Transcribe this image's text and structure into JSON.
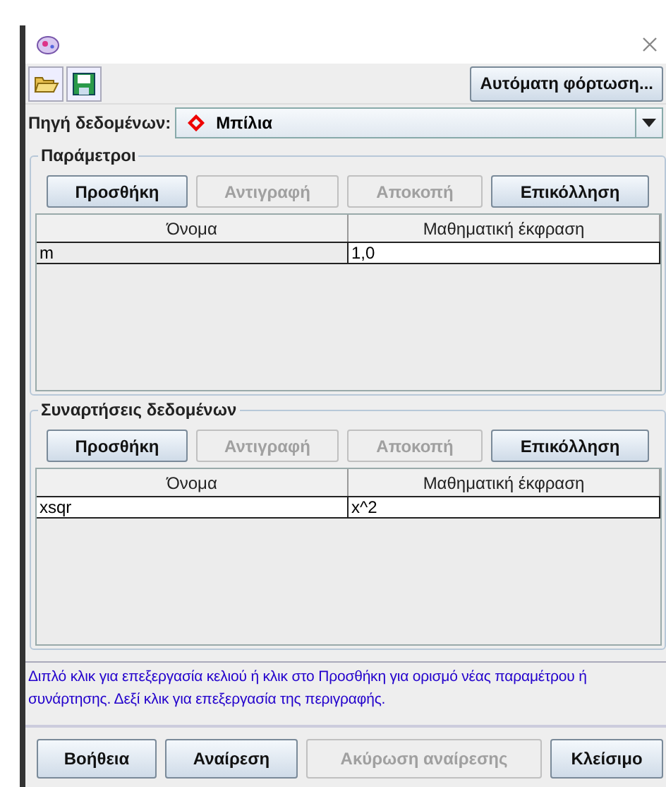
{
  "toolbar": {
    "auto_load_button": "Αυτόματη φόρτωση..."
  },
  "data_source": {
    "label": "Πηγή δεδομένων:",
    "value": "Μπίλια"
  },
  "sections": [
    {
      "title": "Παράμετροι",
      "buttons": [
        {
          "label": "Προσθήκη",
          "disabled": false
        },
        {
          "label": "Αντιγραφή",
          "disabled": true
        },
        {
          "label": "Αποκοπή",
          "disabled": true
        },
        {
          "label": "Επικόλληση",
          "disabled": false
        }
      ],
      "columns": [
        "Όνομα",
        "Μαθηματική έκφραση"
      ],
      "rows": [
        {
          "cells": [
            {
              "text": "m",
              "selected": false
            },
            {
              "text": "1,0",
              "selected": true
            }
          ]
        }
      ]
    },
    {
      "title": "Συναρτήσεις δεδομένων",
      "buttons": [
        {
          "label": "Προσθήκη",
          "disabled": false
        },
        {
          "label": "Αντιγραφή",
          "disabled": true
        },
        {
          "label": "Αποκοπή",
          "disabled": true
        },
        {
          "label": "Επικόλληση",
          "disabled": false
        }
      ],
      "columns": [
        "Όνομα",
        "Μαθηματική έκφραση"
      ],
      "rows": [
        {
          "cells": [
            {
              "text": "xsqr",
              "selected": true
            },
            {
              "text": "x^2",
              "selected": true
            }
          ]
        }
      ]
    }
  ],
  "help_text": "Διπλό κλικ για επεξεργασία κελιού ή κλικ στο Προσθήκη για ορισμό νέας παραμέτρου ή συνάρτησης.  Δεξί κλικ για επεξεργασία της περιγραφής.",
  "footer_buttons": [
    {
      "label": "Βοήθεια",
      "disabled": false
    },
    {
      "label": "Αναίρεση",
      "disabled": false
    },
    {
      "label": "Ακύρωση αναίρεσης",
      "disabled": true
    },
    {
      "label": "Κλείσιμο",
      "disabled": false
    }
  ]
}
